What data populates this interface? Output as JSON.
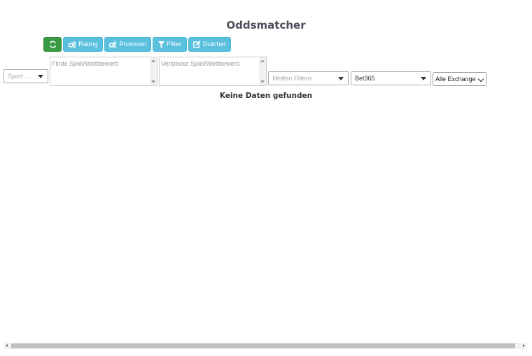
{
  "page": {
    "title": "Oddsmatcher"
  },
  "toolbar": {
    "rating_label": "Rating",
    "provision_label": "Provision",
    "filter_label": "Filter",
    "dutcher_label": "Dutcher",
    "refresh_color": "#3a9a44",
    "action_color": "#5bc0de"
  },
  "filters": {
    "sport_placeholder": "Sport ...",
    "find_placeholder": "Finde Spiel/Wettbewerb",
    "hide_placeholder": "Verstecke Spiel/Wettbewerb",
    "bets_placeholder": "Wetten Filtern",
    "bookmaker_value": "Bet365",
    "exchange_value": "Alle Exchange"
  },
  "results": {
    "empty_message": "Keine Daten gefunden"
  }
}
